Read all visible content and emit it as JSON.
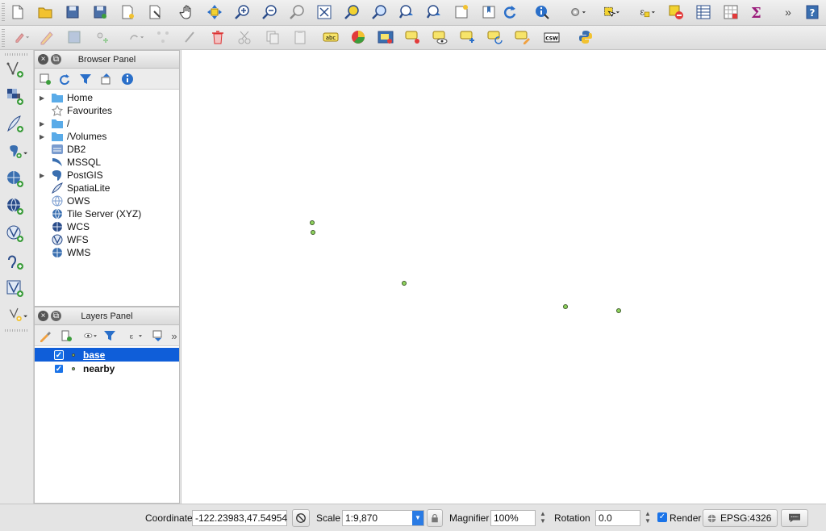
{
  "browser_panel": {
    "title": "Browser Panel",
    "items": [
      {
        "label": "Home",
        "icon": "folder-icon",
        "expandable": true
      },
      {
        "label": "Favourites",
        "icon": "star-icon",
        "expandable": false
      },
      {
        "label": "/",
        "icon": "folder-icon",
        "expandable": true
      },
      {
        "label": "/Volumes",
        "icon": "folder-icon",
        "expandable": true
      },
      {
        "label": "DB2",
        "icon": "db2-icon",
        "expandable": false
      },
      {
        "label": "MSSQL",
        "icon": "mssql-icon",
        "expandable": false
      },
      {
        "label": "PostGIS",
        "icon": "postgis-icon",
        "expandable": true
      },
      {
        "label": "SpatiaLite",
        "icon": "spatialite-icon",
        "expandable": false
      },
      {
        "label": "OWS",
        "icon": "ows-icon",
        "expandable": false
      },
      {
        "label": "Tile Server (XYZ)",
        "icon": "xyz-icon",
        "expandable": false
      },
      {
        "label": "WCS",
        "icon": "wcs-icon",
        "expandable": false
      },
      {
        "label": "WFS",
        "icon": "wfs-icon",
        "expandable": false
      },
      {
        "label": "WMS",
        "icon": "wms-icon",
        "expandable": false
      }
    ]
  },
  "layers_panel": {
    "title": "Layers Panel",
    "layers": [
      {
        "name": "base",
        "checked": true,
        "selected": true
      },
      {
        "name": "nearby",
        "checked": true,
        "selected": false
      }
    ]
  },
  "toolbar_badges": {
    "csw": "CSW",
    "abc": "abc",
    "more": "»",
    "help": "?"
  },
  "statusbar": {
    "coordinate_label": "Coordinate",
    "coordinate_value": "-122.23983,47.54954",
    "scale_label": "Scale",
    "scale_value": "1:9,870",
    "magnifier_label": "Magnifier",
    "magnifier_value": "100%",
    "rotation_label": "Rotation",
    "rotation_value": "0.0",
    "render_label": "Render",
    "render_checked": true,
    "crs_label": "EPSG:4326"
  },
  "colors": {
    "selection": "#0f5ed9",
    "point_fill": "#8fd35d",
    "point_stroke": "#3d5a2a"
  }
}
